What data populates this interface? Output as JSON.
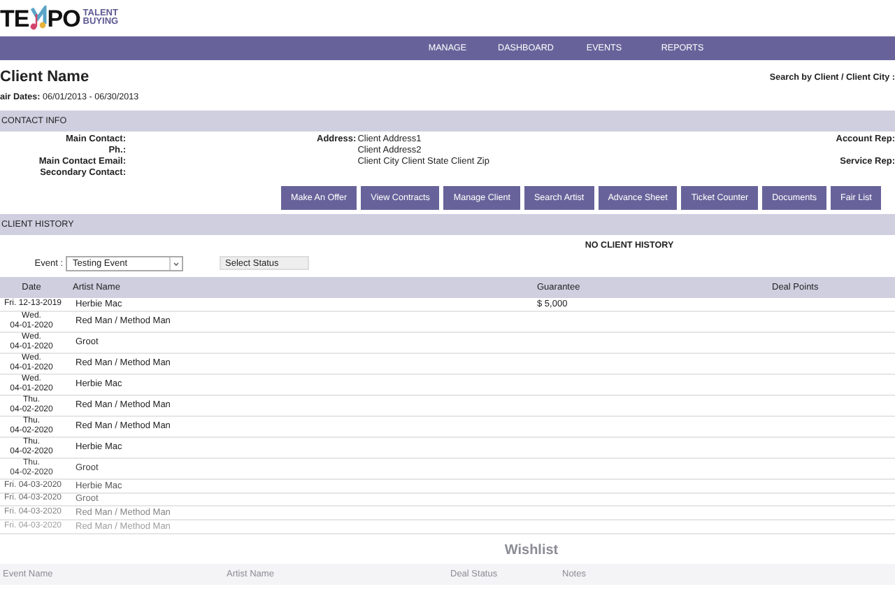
{
  "logo": {
    "left": "TE",
    "right": "PO",
    "tagline": [
      "TALENT",
      "BUYING"
    ]
  },
  "nav": [
    "MANAGE",
    "DASHBOARD",
    "EVENTS",
    "REPORTS"
  ],
  "header": {
    "title": "Client Name",
    "search_label": "Search by Client / Client City :",
    "dates_label": "air Dates:",
    "dates": "06/01/2013 - 06/30/2013"
  },
  "contact_info": {
    "title": "CONTACT INFO",
    "left": [
      {
        "label": "Main Contact:"
      },
      {
        "label": "Ph.:"
      },
      {
        "label": "Main Contact Email:"
      },
      {
        "label": "Secondary Contact:"
      }
    ],
    "address_label": "Address:",
    "address_lines": [
      "Client Address1",
      "Client Address2",
      "Client City Client State Client Zip"
    ],
    "right": [
      "Account Rep:",
      "Service Rep:"
    ]
  },
  "actions": [
    "Make An Offer",
    "View Contracts",
    "Manage Client",
    "Search Artist",
    "Advance Sheet",
    "Ticket Counter",
    "Documents",
    "Fair List"
  ],
  "client_history": {
    "title": "CLIENT HISTORY",
    "message": "NO CLIENT HISTORY",
    "event_label": "Event :",
    "event_value": "Testing Event",
    "status_placeholder": "Select Status",
    "columns": [
      "Date",
      "Artist Name",
      "Guarantee",
      "Deal Points"
    ],
    "rows": [
      {
        "date": [
          "Fri. 12-13-2019"
        ],
        "artist": "Herbie Mac",
        "guarantee": "$ 5,000"
      },
      {
        "date": [
          "Wed.",
          "04-01-2020"
        ],
        "artist": "Red Man / Method Man"
      },
      {
        "date": [
          "Wed.",
          "04-01-2020"
        ],
        "artist": "Groot"
      },
      {
        "date": [
          "Wed.",
          "04-01-2020"
        ],
        "artist": "Red Man / Method Man"
      },
      {
        "date": [
          "Wed.",
          "04-01-2020"
        ],
        "artist": "Herbie Mac"
      },
      {
        "date": [
          "Thu.",
          "04-02-2020"
        ],
        "artist": "Red Man / Method Man"
      },
      {
        "date": [
          "Thu.",
          "04-02-2020"
        ],
        "artist": "Red Man / Method Man"
      },
      {
        "date": [
          "Thu.",
          "04-02-2020"
        ],
        "artist": "Herbie Mac"
      },
      {
        "date": [
          "Thu.",
          "04-02-2020"
        ],
        "artist": "Groot"
      },
      {
        "date": [
          "Fri. 04-03-2020"
        ],
        "artist": "Herbie Mac"
      },
      {
        "date": [
          "Fri. 04-03-2020"
        ],
        "artist": "Groot"
      },
      {
        "date": [
          "Fri. 04-03-2020"
        ],
        "artist": "Red Man / Method Man"
      },
      {
        "date": [
          "Fri. 04-03-2020"
        ],
        "artist": "Red Man / Method Man"
      }
    ]
  },
  "wishlist": {
    "title": "Wishlist",
    "columns": [
      "Event Name",
      "Artist Name",
      "Deal Status",
      "Notes"
    ]
  }
}
